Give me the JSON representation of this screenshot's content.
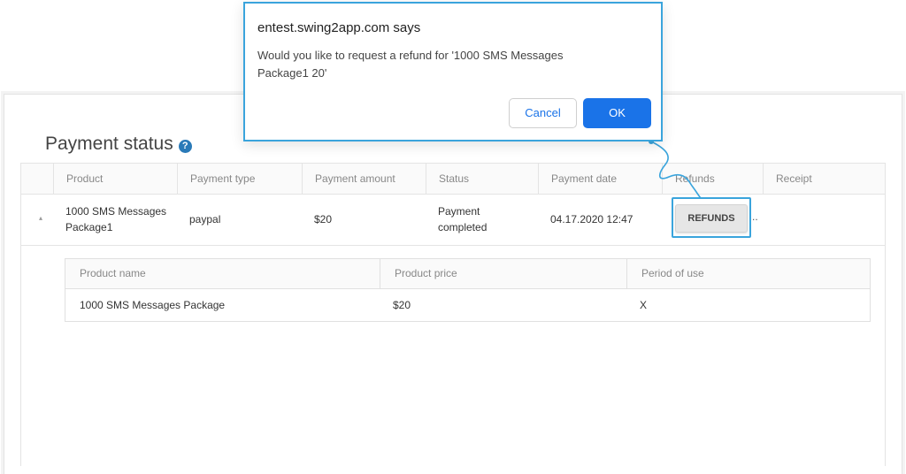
{
  "page": {
    "title": "Payment status",
    "help_icon": "question-circle-icon"
  },
  "table": {
    "headers": [
      "Product",
      "Payment type",
      "Payment amount",
      "Status",
      "Payment date",
      "Refunds",
      "Receipt"
    ],
    "row": {
      "product_line1": "1000 SMS Messages",
      "product_line2": "Package1",
      "payment_type": "paypal",
      "payment_amount": "$20",
      "status_line1": "Payment",
      "status_line2": "completed",
      "payment_date": "04.17.2020 12:47",
      "refunds_button": "REFUNDS",
      "ellipsis": ".."
    }
  },
  "subtable": {
    "headers": [
      "Product name",
      "Product price",
      "Period of use"
    ],
    "row": {
      "product_name": "1000 SMS Messages Package",
      "product_price": "$20",
      "period_of_use": "X"
    }
  },
  "dialog": {
    "title": "entest.swing2app.com says",
    "message_line1": "Would you like to request a refund for '1000 SMS Messages",
    "message_line2": "Package1 20'",
    "cancel_label": "Cancel",
    "ok_label": "OK"
  },
  "colors": {
    "accent": "#1a73e8",
    "highlight": "#3aa4dc",
    "help_icon": "#2a7ab8"
  }
}
